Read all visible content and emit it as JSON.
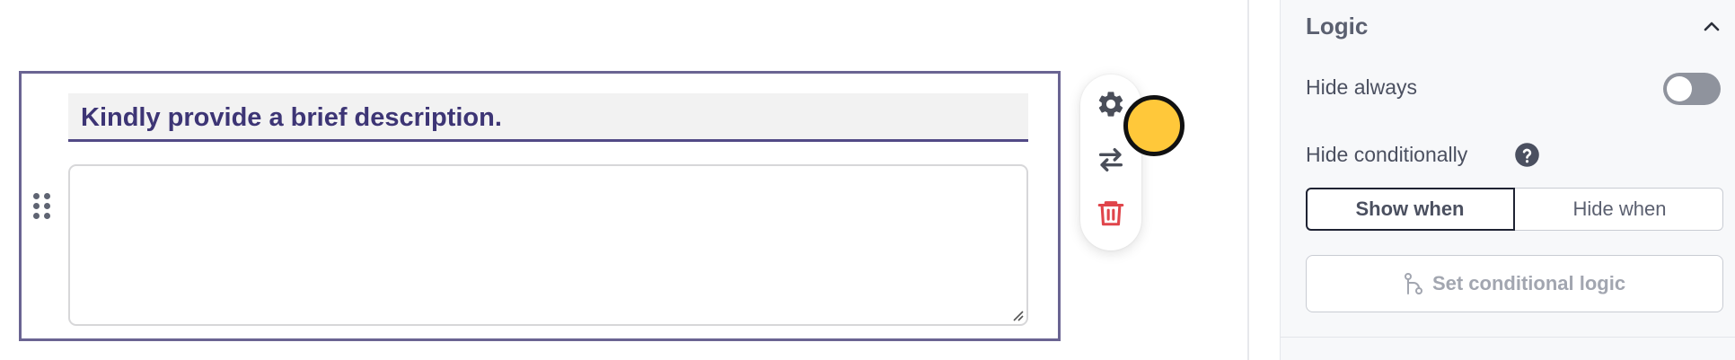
{
  "question": {
    "title": "Kindly provide a brief description.",
    "answer_value": ""
  },
  "toolbar": {
    "icons": [
      "gear-icon",
      "swap-icon",
      "trash-icon"
    ]
  },
  "logic_panel": {
    "title": "Logic",
    "hide_always_label": "Hide always",
    "hide_always_on": false,
    "hide_conditionally_label": "Hide conditionally",
    "condition_options": [
      "Show when",
      "Hide when"
    ],
    "selected_condition": "Show when",
    "set_logic_button": "Set conditional logic"
  },
  "colors": {
    "accent": "#3d3575",
    "block_border": "#6a6492",
    "delete": "#e0454b",
    "cursor": "#ffc83a"
  }
}
